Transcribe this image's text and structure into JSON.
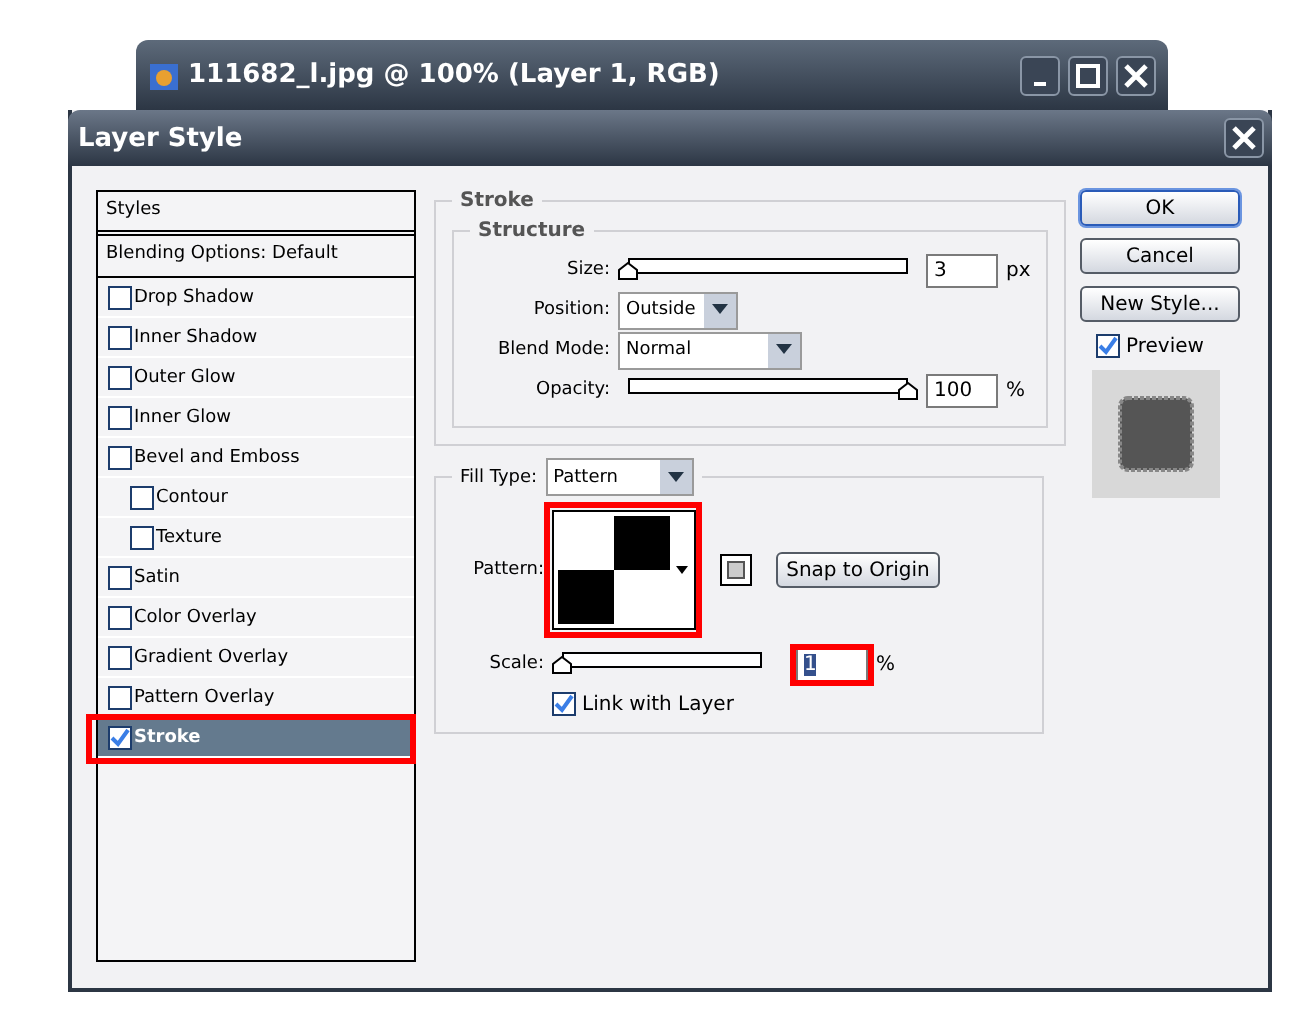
{
  "document_window": {
    "title": "111682_l.jpg @ 100% (Layer 1, RGB)"
  },
  "dialog": {
    "title": "Layer Style"
  },
  "styles_panel": {
    "header": "Styles",
    "blending_options": "Blending Options: Default",
    "items": [
      {
        "label": "Drop Shadow",
        "checked": false,
        "selected": false,
        "annotated": false
      },
      {
        "label": "Inner Shadow",
        "checked": false,
        "selected": false,
        "annotated": false
      },
      {
        "label": "Outer Glow",
        "checked": false,
        "selected": false,
        "annotated": false
      },
      {
        "label": "Inner Glow",
        "checked": false,
        "selected": false,
        "annotated": false
      },
      {
        "label": "Bevel and Emboss",
        "checked": false,
        "selected": false,
        "annotated": false,
        "children": [
          {
            "label": "Contour",
            "checked": false,
            "selected": false,
            "annotated": false
          },
          {
            "label": "Texture",
            "checked": false,
            "selected": false,
            "annotated": false
          }
        ]
      },
      {
        "label": "Satin",
        "checked": false,
        "selected": false,
        "annotated": false
      },
      {
        "label": "Color Overlay",
        "checked": false,
        "selected": false,
        "annotated": false
      },
      {
        "label": "Gradient Overlay",
        "checked": false,
        "selected": false,
        "annotated": false
      },
      {
        "label": "Pattern Overlay",
        "checked": false,
        "selected": false,
        "annotated": false
      },
      {
        "label": "Stroke",
        "checked": true,
        "selected": true,
        "annotated": true
      }
    ]
  },
  "stroke": {
    "title": "Stroke",
    "structure_title": "Structure",
    "size": {
      "label": "Size:",
      "value": "3",
      "unit": "px",
      "level": 0.0
    },
    "position": {
      "label": "Position:",
      "value": "Outside"
    },
    "blend_mode": {
      "label": "Blend Mode:",
      "value": "Normal"
    },
    "opacity": {
      "label": "Opacity:",
      "value": "100",
      "unit": "%",
      "level": 1.0
    },
    "fill_type": {
      "label": "Fill Type:",
      "value": "Pattern"
    },
    "pattern": {
      "label": "Pattern:",
      "annotated": true
    },
    "snap_button": "Snap to Origin",
    "scale": {
      "label": "Scale:",
      "value": "1",
      "unit": "%",
      "level": 0.0,
      "annotated": true
    },
    "link_with_layer": {
      "label": "Link with Layer",
      "checked": true
    }
  },
  "buttons": [
    {
      "label": "OK",
      "default": true
    },
    {
      "label": "Cancel",
      "default": false
    },
    {
      "label": "New Style...",
      "default": false
    }
  ],
  "preview": {
    "label": "Preview",
    "checked": true
  }
}
